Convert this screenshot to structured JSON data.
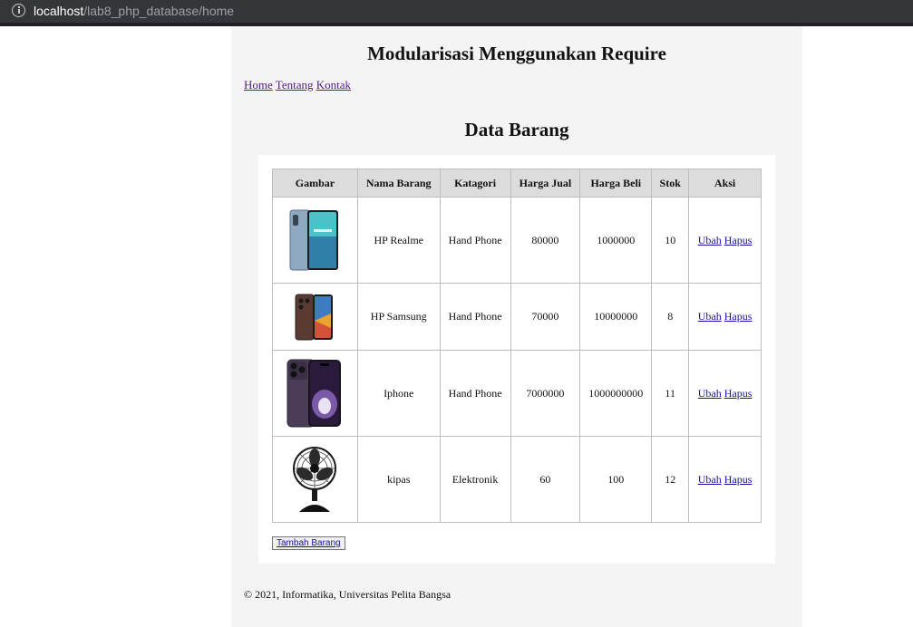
{
  "browser": {
    "url_host": "localhost",
    "url_path": "/lab8_php_database/home"
  },
  "site": {
    "title": "Modularisasi Menggunakan Require",
    "nav": [
      "Home",
      "Tentang",
      "Kontak"
    ]
  },
  "page": {
    "heading": "Data Barang"
  },
  "table": {
    "headers": [
      "Gambar",
      "Nama Barang",
      "Katagori",
      "Harga Jual",
      "Harga Beli",
      "Stok",
      "Aksi"
    ],
    "rows": [
      {
        "image": "phone-realme-image",
        "name": "HP Realme",
        "category": "Hand Phone",
        "sell": "80000",
        "buy": "1000000",
        "stock": "10",
        "edit": "Ubah",
        "delete": "Hapus"
      },
      {
        "image": "phone-samsung-image",
        "name": "HP Samsung",
        "category": "Hand Phone",
        "sell": "70000",
        "buy": "10000000",
        "stock": "8",
        "edit": "Ubah",
        "delete": "Hapus"
      },
      {
        "image": "iphone-image",
        "name": "Iphone",
        "category": "Hand Phone",
        "sell": "7000000",
        "buy": "1000000000",
        "stock": "11",
        "edit": "Ubah",
        "delete": "Hapus"
      },
      {
        "image": "fan-image",
        "name": "kipas",
        "category": "Elektronik",
        "sell": "60",
        "buy": "100",
        "stock": "12",
        "edit": "Ubah",
        "delete": "Hapus"
      }
    ]
  },
  "actions": {
    "add_label": "Tambah Barang"
  },
  "footer": {
    "text": "© 2021, Informatika, Universitas Pelita Bangsa"
  }
}
